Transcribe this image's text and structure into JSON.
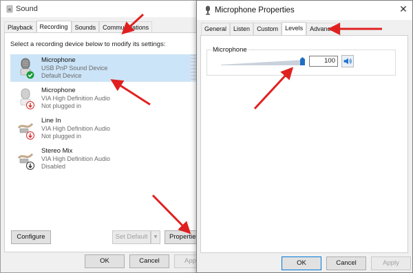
{
  "sound_window": {
    "title": "Sound",
    "tabs": [
      {
        "label": "Playback"
      },
      {
        "label": "Recording"
      },
      {
        "label": "Sounds"
      },
      {
        "label": "Communications"
      }
    ],
    "instructions": "Select a recording device below to modify its settings:",
    "devices": [
      {
        "name": "Microphone",
        "description": "USB PnP Sound Device",
        "status": "Default Device",
        "selected": true,
        "icon": "microphone-icon",
        "badge": "check"
      },
      {
        "name": "Microphone",
        "description": "VIA High Definition Audio",
        "status": "Not plugged in",
        "selected": false,
        "icon": "microphone-icon",
        "badge": "unplugged"
      },
      {
        "name": "Line In",
        "description": "VIA High Definition Audio",
        "status": "Not plugged in",
        "selected": false,
        "icon": "line-in-jack-icon",
        "badge": "unplugged"
      },
      {
        "name": "Stereo Mix",
        "description": "VIA High Definition Audio",
        "status": "Disabled",
        "selected": false,
        "icon": "stereo-mix-icon",
        "badge": "disabled"
      }
    ],
    "buttons": {
      "configure": "Configure",
      "set_default": "Set Default",
      "properties": "Properties",
      "ok": "OK",
      "cancel": "Cancel",
      "apply": "Appl"
    }
  },
  "props_window": {
    "title": "Microphone Properties",
    "tabs": [
      {
        "label": "General"
      },
      {
        "label": "Listen"
      },
      {
        "label": "Custom"
      },
      {
        "label": "Levels"
      },
      {
        "label": "Advanced"
      }
    ],
    "levels": {
      "group_label": "Microphone",
      "value": "100",
      "slider_fraction": 1.0
    },
    "buttons": {
      "ok": "OK",
      "cancel": "Cancel",
      "apply": "Apply"
    }
  },
  "colors": {
    "annotation_arrow": "#e02020",
    "selection": "#cce4f7",
    "accent": "#0078d7",
    "check_badge": "#1a9b3a",
    "unplugged_badge": "#d42a2a"
  }
}
